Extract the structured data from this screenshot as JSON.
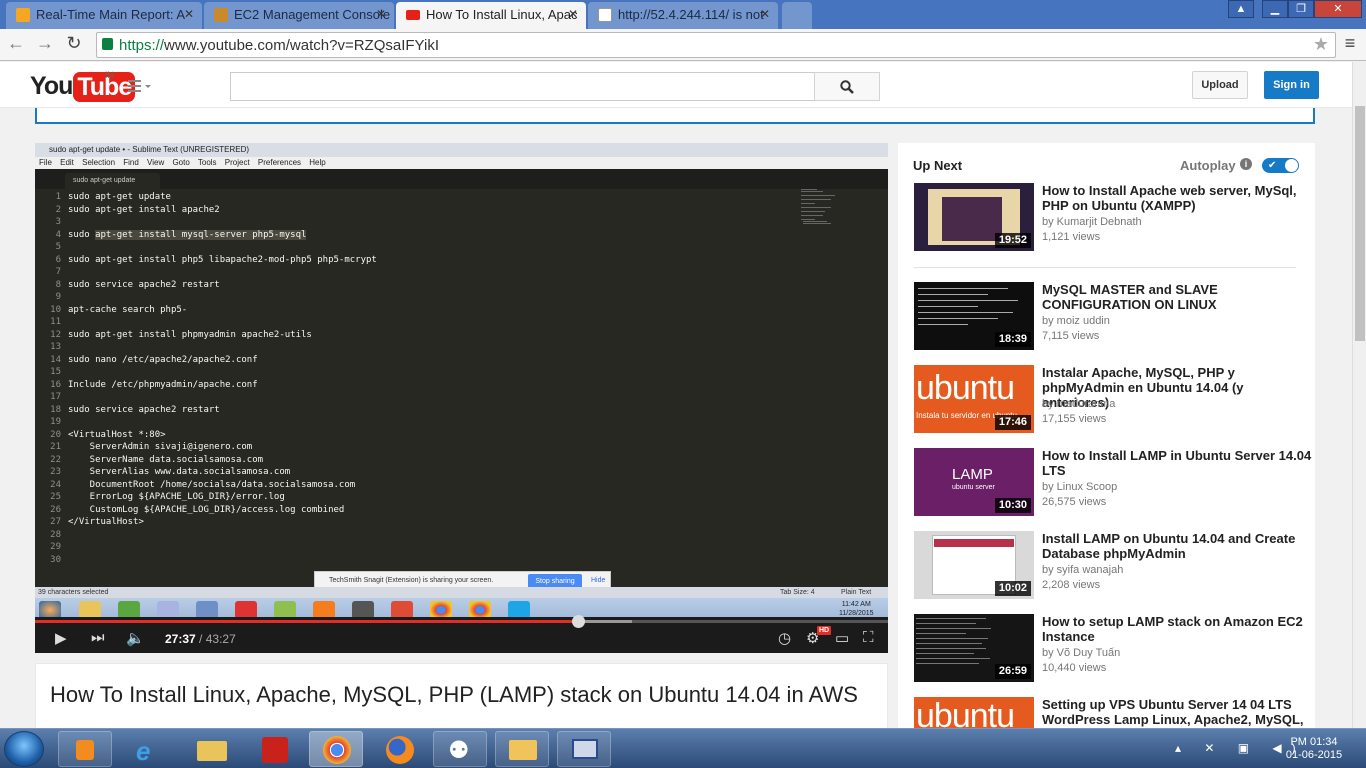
{
  "browser": {
    "tabs": [
      {
        "title": "Real-Time Main Report: A",
        "icon": "analytics-icon",
        "color": "#f5a623"
      },
      {
        "title": "EC2 Management Console",
        "icon": "aws-cube-icon",
        "color": "#c88a2b"
      },
      {
        "title": "How To Install Linux, Apac",
        "icon": "youtube-icon",
        "color": "#e62117"
      },
      {
        "title": "http://52.4.244.114/ is not",
        "icon": "page-icon",
        "color": "#ffffff"
      }
    ],
    "url_scheme": "https://",
    "url_rest": "www.youtube.com/watch?v=RZQsaIFYikI"
  },
  "youtube": {
    "logo_you": "You",
    "logo_tube": "Tube",
    "country": "IN",
    "search_placeholder": "",
    "upload_label": "Upload",
    "signin_label": "Sign in"
  },
  "player": {
    "sublime_title": "sudo apt-get update • - Sublime Text (UNREGISTERED)",
    "sublime_menu": "File Edit Selection Find View Goto Tools Project Preferences Help",
    "sublime_tab": "sudo apt-get update",
    "line_numbers": "1\n2\n3\n4\n5\n6\n7\n8\n9\n10\n11\n12\n13\n14\n15\n16\n17\n18\n19\n20\n21\n22\n23\n24\n25\n26\n27\n28\n29\n30",
    "code_lines": [
      "sudo apt-get update",
      "sudo apt-get install apache2",
      "",
      "sudo |apt-get install mysql-server php5-mysql|",
      "",
      "sudo apt-get install php5 libapache2-mod-php5 php5-mcrypt",
      "",
      "sudo service apache2 restart",
      "",
      "apt-cache search php5-",
      "",
      "sudo apt-get install phpmyadmin apache2-utils",
      "",
      "sudo nano /etc/apache2/apache2.conf",
      "",
      "Include /etc/phpmyadmin/apache.conf",
      "",
      "sudo service apache2 restart",
      "",
      "<VirtualHost *:80>",
      "    ServerAdmin sivaji@igenero.com",
      "    ServerName data.socialsamosa.com",
      "    ServerAlias www.data.socialsamosa.com",
      "    DocumentRoot /home/socialsa/data.socialsamosa.com",
      "    ErrorLog ${APACHE_LOG_DIR}/error.log",
      "    CustomLog ${APACHE_LOG_DIR}/access.log combined",
      "</VirtualHost>",
      "",
      "",
      ""
    ],
    "status_left": "39 characters selected",
    "status_tab": "Tab Size: 4",
    "status_syntax": "Plain Text",
    "snagit_text": "TechSmith Snagit (Extension) is sharing your screen.",
    "snagit_stop": "Stop sharing",
    "snagit_hide": "Hide",
    "inner_time": "11:42 AM",
    "inner_date": "11/28/2015",
    "current_time": "27:37",
    "separator": " / ",
    "duration": "43:27",
    "progress_fraction": 0.636,
    "hd_badge": "HD"
  },
  "video": {
    "title": "How To Install Linux, Apache, MySQL, PHP (LAMP) stack on Ubuntu 14.04 in AWS"
  },
  "sidebar": {
    "up_next": "Up Next",
    "autoplay": "Autoplay",
    "info": "i",
    "items": [
      {
        "title": "How to Install Apache web server, MySql, PHP on Ubuntu (XAMPP)",
        "channel": "by Kumarjit Debnath",
        "views": "1,121 views",
        "duration": "19:52",
        "thumb_color": "#2a1f3d"
      },
      {
        "title": "MySQL MASTER and SLAVE CONFIGURATION ON LINUX",
        "channel": "by moiz uddin",
        "views": "7,115 views",
        "duration": "18:39",
        "thumb_color": "#0e0e0e"
      },
      {
        "title": "Instalar Apache, MySQL, PHP y phpMyAdmin en Ubuntu 14.04 (y anteriores)",
        "channel": "by maduranma",
        "views": "17,155 views",
        "duration": "17:46",
        "thumb_color": "#e55b1f",
        "thumb_text": "ubuntu",
        "thumb_sub": "Instala tu servidor en ubuntu"
      },
      {
        "title": "How to Install LAMP in Ubuntu Server 14.04 LTS",
        "channel": "by Linux Scoop",
        "views": "26,575 views",
        "duration": "10:30",
        "thumb_color": "#6b1f66",
        "thumb_text": "LAMP",
        "thumb_sub": "ubuntu server"
      },
      {
        "title": "Install LAMP on Ubuntu 14.04 and Create Database phpMyAdmin",
        "channel": "by syifa wanajah",
        "views": "2,208 views",
        "duration": "10:02",
        "thumb_color": "#d9d9d9"
      },
      {
        "title": "How to setup LAMP stack on Amazon EC2 Instance",
        "channel": "by Võ Duy Tuấn",
        "views": "10,440 views",
        "duration": "26:59",
        "thumb_color": "#151515"
      },
      {
        "title": "Setting up VPS Ubuntu Server 14 04 LTS WordPress Lamp Linux, Apache2, MySQL,",
        "channel": "",
        "views": "",
        "duration": "",
        "thumb_color": "#e55b1f",
        "thumb_text": "ubuntu"
      }
    ]
  },
  "taskbar": {
    "time": "PM 01:34",
    "date": "01-06-2015",
    "apps": [
      "media-player-icon",
      "internet-explorer-icon",
      "file-explorer-icon",
      "acrobat-icon",
      "chrome-icon",
      "firefox-icon",
      "network-icon",
      "outlook-icon",
      "remote-desktop-icon"
    ]
  }
}
